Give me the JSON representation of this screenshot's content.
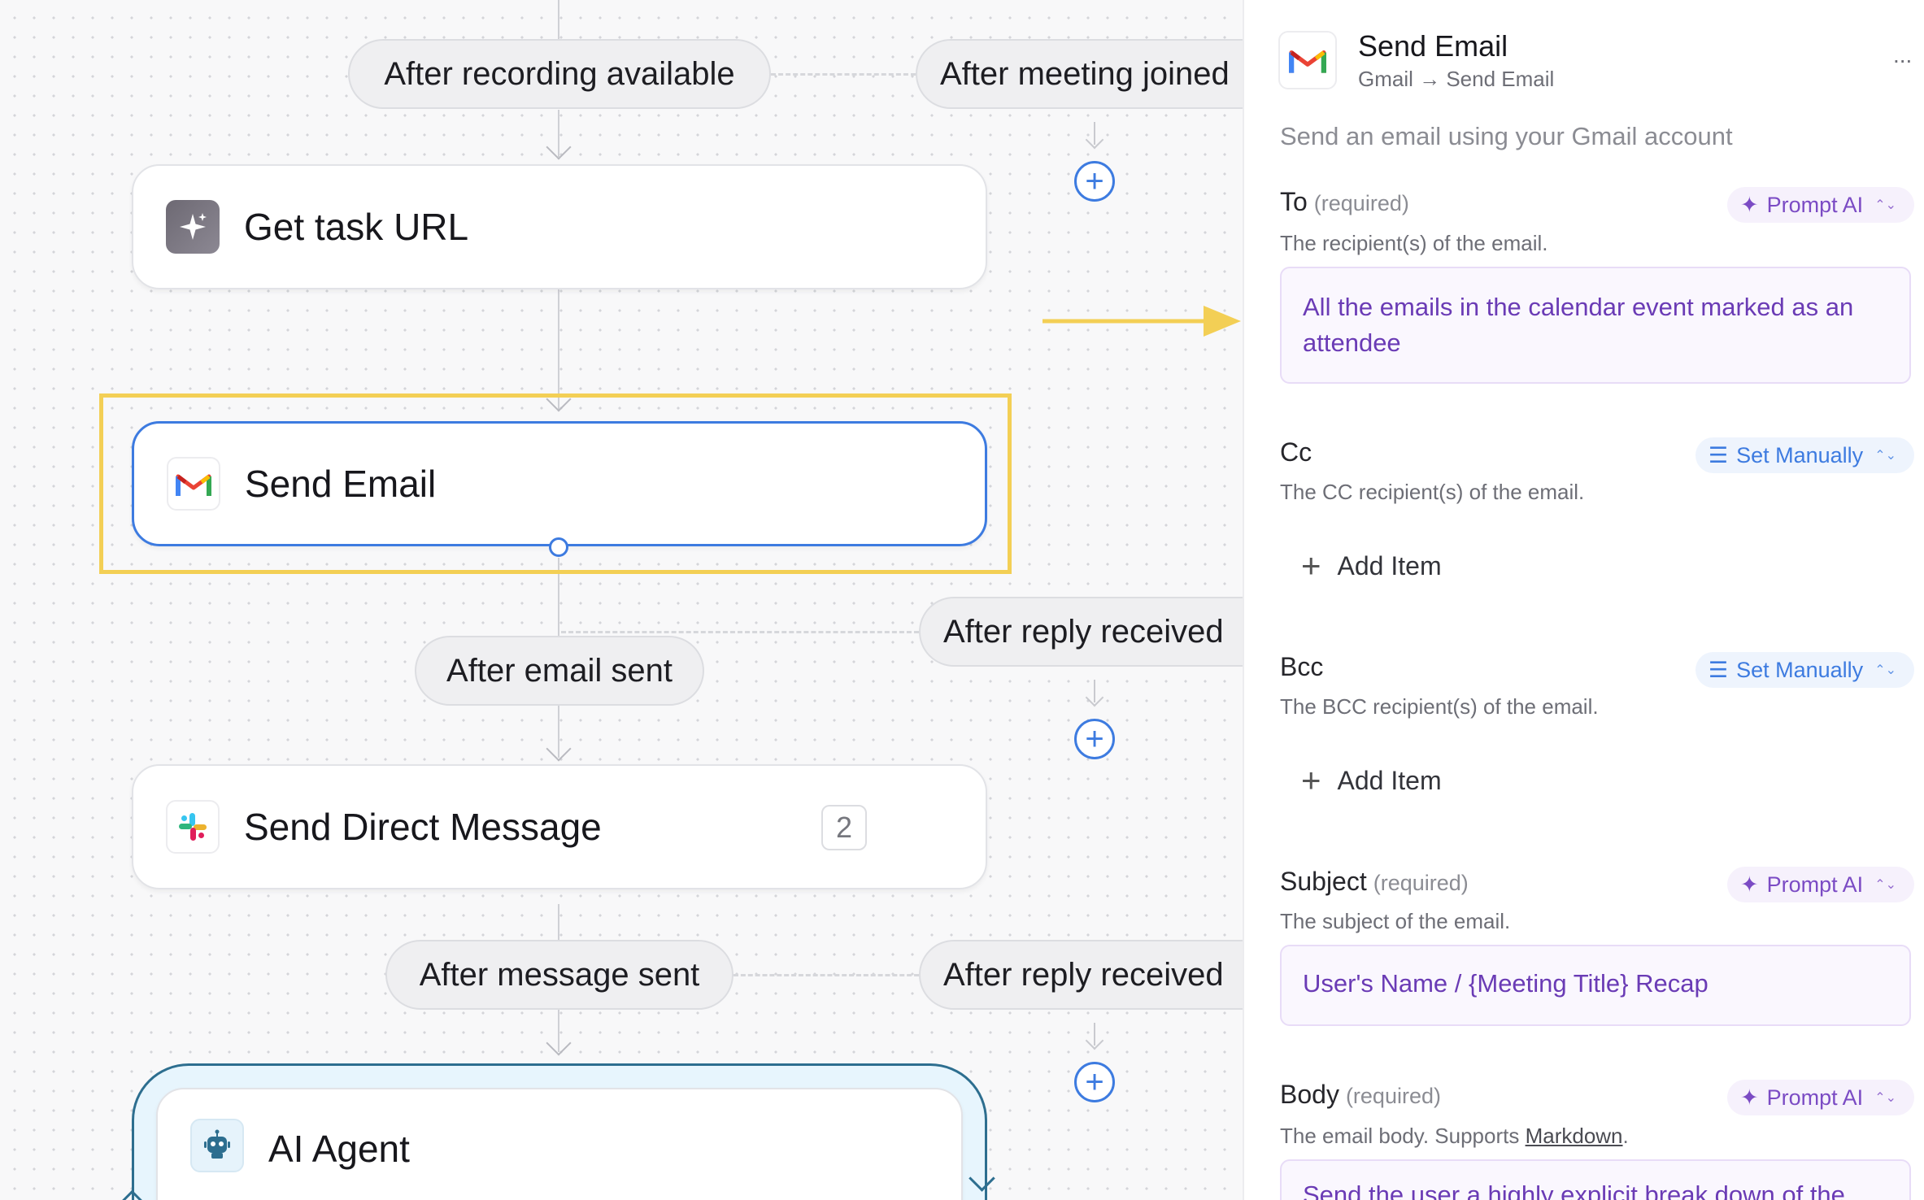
{
  "canvas": {
    "triggers": {
      "after_recording": "After recording available",
      "after_meeting_joined": "After meeting joined",
      "after_email_sent": "After email sent",
      "after_reply_received_1": "After reply received",
      "after_message_sent": "After message sent",
      "after_reply_received_2": "After reply received"
    },
    "nodes": {
      "get_task_url": {
        "title": "Get task URL",
        "icon": "sparkle-icon"
      },
      "send_email": {
        "title": "Send Email",
        "icon": "gmail-icon"
      },
      "send_dm": {
        "title": "Send Direct Message",
        "icon": "slack-icon",
        "badge": "2"
      },
      "ai_agent": {
        "title": "AI Agent",
        "icon": "robot-icon"
      }
    },
    "colors": {
      "accent": "#3d7be0",
      "highlight": "#f3cf55"
    }
  },
  "panel": {
    "title": "Send Email",
    "breadcrumb": "Gmail → Send Email",
    "more": "...",
    "description": "Send an email using your Gmail account",
    "fields": {
      "to": {
        "label": "To",
        "required": "(required)",
        "mode": "Prompt AI",
        "desc": "The recipient(s) of the email.",
        "value": "All the emails in the calendar event marked as an attendee"
      },
      "cc": {
        "label": "Cc",
        "mode": "Set Manually",
        "desc": "The CC recipient(s) of the email.",
        "add": "Add Item"
      },
      "bcc": {
        "label": "Bcc",
        "mode": "Set Manually",
        "desc": "The BCC recipient(s) of the email.",
        "add": "Add Item"
      },
      "subject": {
        "label": "Subject",
        "required": "(required)",
        "mode": "Prompt AI",
        "desc": "The subject of the email.",
        "value": "User's Name / {Meeting Title} Recap"
      },
      "body": {
        "label": "Body",
        "required": "(required)",
        "mode": "Prompt AI",
        "desc_prefix": "The email body. Supports ",
        "desc_link": "Markdown",
        "desc_suffix": ".",
        "value": "Send the user a highly explicit break down of the"
      }
    }
  }
}
